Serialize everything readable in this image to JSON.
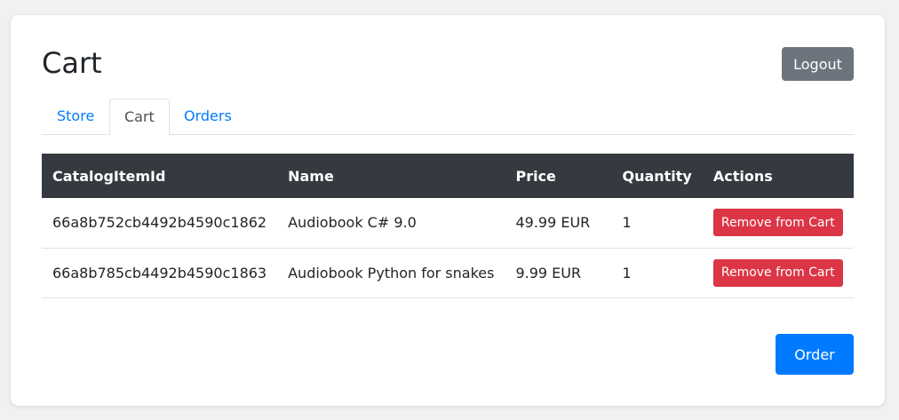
{
  "header": {
    "title": "Cart",
    "logout_label": "Logout"
  },
  "tabs": [
    {
      "label": "Store",
      "active": false
    },
    {
      "label": "Cart",
      "active": true
    },
    {
      "label": "Orders",
      "active": false
    }
  ],
  "table": {
    "columns": [
      "CatalogItemId",
      "Name",
      "Price",
      "Quantity",
      "Actions"
    ],
    "rows": [
      {
        "catalog_item_id": "66a8b752cb4492b4590c1862",
        "name": "Audiobook C# 9.0",
        "price": "49.99 EUR",
        "quantity": "1",
        "action_label": "Remove from Cart"
      },
      {
        "catalog_item_id": "66a8b785cb4492b4590c1863",
        "name": "Audiobook Python for snakes",
        "price": "9.99 EUR",
        "quantity": "1",
        "action_label": "Remove from Cart"
      }
    ]
  },
  "order_label": "Order",
  "colors": {
    "primary": "#007bff",
    "secondary": "#6c757d",
    "danger": "#dc3545",
    "table_header": "#343a40"
  }
}
